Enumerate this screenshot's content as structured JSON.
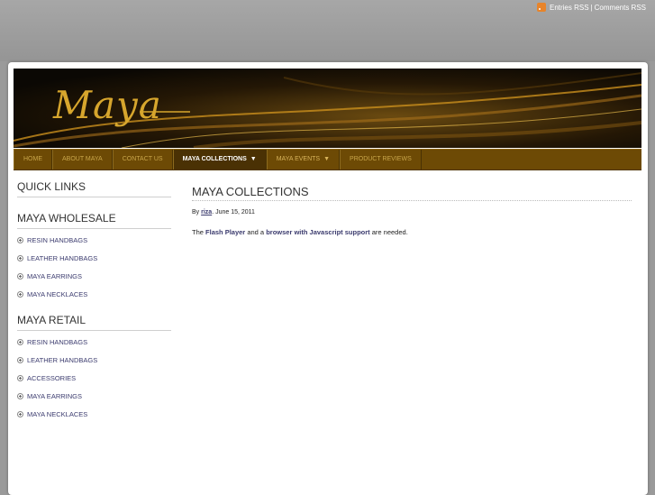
{
  "header": {
    "entries_rss": "Entries RSS",
    "separator": "|",
    "comments_rss": "Comments RSS"
  },
  "banner": {
    "logo_text": "Maya"
  },
  "nav": {
    "items": [
      {
        "label": "Home"
      },
      {
        "label": "About Maya"
      },
      {
        "label": "Contact Us"
      },
      {
        "label": "Maya Collections"
      },
      {
        "label": "Maya Events"
      },
      {
        "label": "Product Reviews"
      }
    ],
    "dropdown_caret": "▼"
  },
  "sidebar": {
    "quick_links": "QUICK LINKS",
    "wholesale": {
      "title": "MAYA WHOLESALE",
      "items": [
        "RESIN HANDBAGS",
        "LEATHER HANDBAGS",
        "MAYA EARRINGS",
        "MAYA NECKLACES"
      ]
    },
    "retail": {
      "title": "MAYA RETAIL",
      "items": [
        "RESIN HANDBAGS",
        "LEATHER HANDBAGS",
        "ACCESSORIES",
        "MAYA EARRINGS",
        "MAYA NECKLACES"
      ]
    }
  },
  "post": {
    "title": "MAYA COLLECTIONS",
    "by": "By",
    "author": "riza",
    "date": ". June 15, 2011",
    "text_the": "The",
    "flash_link": "Flash Player",
    "text_and": "and a",
    "browser_link": "browser with Javascript support",
    "text_end": "are needed."
  },
  "colors": {
    "nav_bg": "#6d4a05",
    "gold": "#d7a62d",
    "link": "#3b3b6e"
  }
}
